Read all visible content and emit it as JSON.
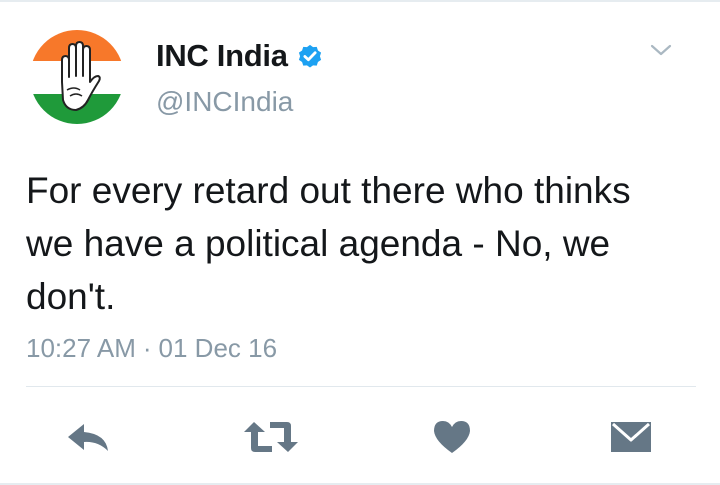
{
  "tweet": {
    "display_name": "INC India",
    "handle": "@INCIndia",
    "text": "For every retard out there who thinks we have a political agenda - No, we don't.",
    "time": "10:27 AM",
    "separator": "·",
    "date": "01 Dec 16",
    "verified": true
  },
  "avatar": {
    "icon": "inc-hand-logo-icon",
    "colors": {
      "saffron": "#f7782a",
      "white": "#ffffff",
      "green": "#1f9a3a"
    }
  },
  "icons": {
    "verified": "verified-badge-icon",
    "menu": "chevron-down-icon",
    "reply": "reply-icon",
    "retweet": "retweet-icon",
    "like": "heart-icon",
    "message": "direct-message-icon"
  },
  "colors": {
    "text_primary": "#14171a",
    "text_secondary": "#8899a6",
    "action_icon": "#657786",
    "verified_blue": "#1da1f2"
  }
}
